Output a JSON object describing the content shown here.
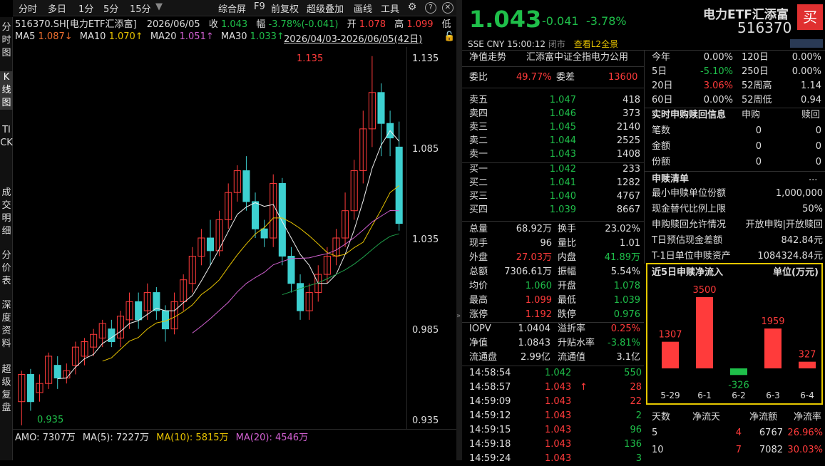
{
  "left_sidebar": [
    "分时图",
    "K线图",
    "TICK",
    "成交明细",
    "分价表",
    "深度资料",
    "超级复盘"
  ],
  "toolbar": {
    "items": [
      "分时",
      "多日",
      "1分",
      "5分",
      "15分"
    ],
    "right_items": [
      "综合屏",
      "F9",
      "前复权",
      "超级叠加",
      "画线",
      "工具"
    ]
  },
  "chart_header": {
    "code": "516370.SH[电力ETF汇添富]",
    "date": "2026/06/05",
    "close_label": "收",
    "close": "1.043",
    "change_label": "幅",
    "change": "-3.78%(-0.041)",
    "open_label": "开",
    "open": "1.078",
    "high_label": "高",
    "high": "1.099",
    "low_label": "低"
  },
  "ma_bar": {
    "ma5": "MA5",
    "ma5v": "1.087↓",
    "ma10": "MA10",
    "ma10v": "1.070↑",
    "ma20": "MA20",
    "ma20v": "1.051↑",
    "ma30": "MA30",
    "ma30v": "1.033↑",
    "range": "2026/04/03-2026/06/05(42日)"
  },
  "price_axis": [
    "1.135",
    "1.085",
    "1.035",
    "0.985",
    "0.935"
  ],
  "annotations": {
    "high": "1.135",
    "low": "0.935"
  },
  "amo": {
    "label": "AMO: 7307万",
    "ma5": "MA(5): 7227万",
    "ma10": "MA(10): 5815万",
    "ma20": "MA(20): 4546万"
  },
  "chart_data": {
    "type": "candlestick",
    "ylim": [
      0.93,
      1.14
    ],
    "candles": [
      [
        0.945,
        0.96,
        0.932,
        0.962
      ],
      [
        0.96,
        0.945,
        0.94,
        0.963
      ],
      [
        0.95,
        0.955,
        0.945,
        0.96
      ],
      [
        0.955,
        0.97,
        0.952,
        0.972
      ],
      [
        0.965,
        0.958,
        0.952,
        0.97
      ],
      [
        0.958,
        0.962,
        0.955,
        0.966
      ],
      [
        0.965,
        0.975,
        0.96,
        0.978
      ],
      [
        0.97,
        0.978,
        0.965,
        0.98
      ],
      [
        0.975,
        0.982,
        0.97,
        0.985
      ],
      [
        0.98,
        0.988,
        0.975,
        0.99
      ],
      [
        0.985,
        0.978,
        0.975,
        0.99
      ],
      [
        0.98,
        0.992,
        0.975,
        0.995
      ],
      [
        0.99,
        1.0,
        0.985,
        1.005
      ],
      [
        1.0,
        0.99,
        0.985,
        1.005
      ],
      [
        0.995,
        1.005,
        0.99,
        1.01
      ],
      [
        1.005,
        0.995,
        0.99,
        1.008
      ],
      [
        0.995,
        0.985,
        0.978,
        0.998
      ],
      [
        0.985,
        1.0,
        0.982,
        1.005
      ],
      [
        1.0,
        1.012,
        0.995,
        1.015
      ],
      [
        1.01,
        1.025,
        1.005,
        1.03
      ],
      [
        1.025,
        1.035,
        1.02,
        1.04
      ],
      [
        1.035,
        1.028,
        1.02,
        1.045
      ],
      [
        1.028,
        1.045,
        1.025,
        1.05
      ],
      [
        1.045,
        1.06,
        1.04,
        1.065
      ],
      [
        1.06,
        1.072,
        1.055,
        1.075
      ],
      [
        1.072,
        1.055,
        1.05,
        1.08
      ],
      [
        1.055,
        1.04,
        1.035,
        1.06
      ],
      [
        1.04,
        1.035,
        1.03,
        1.045
      ],
      [
        1.035,
        1.065,
        1.03,
        1.07
      ],
      [
        1.065,
        1.025,
        1.02,
        1.068
      ],
      [
        1.025,
        1.01,
        1.005,
        1.03
      ],
      [
        1.01,
        0.995,
        0.99,
        1.015
      ],
      [
        0.995,
        1.005,
        0.99,
        1.01
      ],
      [
        1.005,
        1.015,
        1.0,
        1.02
      ],
      [
        1.015,
        1.025,
        1.01,
        1.03
      ],
      [
        1.025,
        1.035,
        1.02,
        1.04
      ],
      [
        1.035,
        1.05,
        1.03,
        1.06
      ],
      [
        1.05,
        1.072,
        1.045,
        1.078
      ],
      [
        1.072,
        1.095,
        1.065,
        1.105
      ],
      [
        1.095,
        1.115,
        1.085,
        1.135
      ],
      [
        1.115,
        1.098,
        1.08,
        1.12
      ],
      [
        1.098,
        1.09,
        1.08,
        1.105
      ],
      [
        1.085,
        1.043,
        1.039,
        1.099
      ]
    ]
  },
  "quote": {
    "price": "1.043",
    "chg": "-0.041",
    "pct": "-3.78%",
    "name": "电力ETF汇添富",
    "code": "516370",
    "buy": "买",
    "exch": "SSE",
    "cur": "CNY",
    "time": "15:00:12",
    "status": "闭市",
    "l2": "查看L2全景"
  },
  "net_title": "净值走势",
  "index_name": "汇添富中证全指电力公用",
  "weibi": {
    "label": "委比",
    "v": "49.77%",
    "label2": "委差",
    "v2": "13600"
  },
  "asks": [
    [
      "卖五",
      "1.047",
      "418"
    ],
    [
      "卖四",
      "1.046",
      "373"
    ],
    [
      "卖三",
      "1.045",
      "2140"
    ],
    [
      "卖二",
      "1.044",
      "2525"
    ],
    [
      "卖一",
      "1.043",
      "1408"
    ]
  ],
  "bids": [
    [
      "买一",
      "1.042",
      "233"
    ],
    [
      "买二",
      "1.041",
      "1282"
    ],
    [
      "买三",
      "1.040",
      "4767"
    ],
    [
      "买四",
      "1.039",
      "8667"
    ]
  ],
  "stats": [
    [
      "总量",
      "68.92万",
      "换手",
      "23.02%"
    ],
    [
      "现手",
      "96",
      "量比",
      "1.01"
    ],
    [
      "外盘",
      "27.03万",
      "内盘",
      "41.89万"
    ],
    [
      "总额",
      "7306.61万",
      "振幅",
      "5.54%"
    ],
    [
      "均价",
      "1.060",
      "开盘",
      "1.078"
    ],
    [
      "最高",
      "1.099",
      "最低",
      "1.039"
    ],
    [
      "涨停",
      "1.192",
      "跌停",
      "0.976"
    ]
  ],
  "iopv": [
    [
      "IOPV",
      "1.0404",
      "溢折率",
      "0.25%"
    ],
    [
      "净值",
      "1.0843",
      "升贴水率",
      "-3.81%"
    ],
    [
      "流通盘",
      "2.99亿",
      "流通值",
      "3.1亿"
    ]
  ],
  "ticks": [
    [
      "14:58:54",
      "1.042",
      "550"
    ],
    [
      "14:58:57",
      "1.043",
      "28"
    ],
    [
      "14:59:09",
      "1.043",
      "22"
    ],
    [
      "14:59:12",
      "1.043",
      "2"
    ],
    [
      "14:59:15",
      "1.043",
      "96"
    ],
    [
      "14:59:18",
      "1.043",
      "136"
    ],
    [
      "14:59:24",
      "1.043",
      "3"
    ]
  ],
  "perf": [
    [
      "今年",
      "0.00%",
      "120日",
      "0.00%"
    ],
    [
      "5日",
      "-5.10%",
      "250日",
      "0.00%"
    ],
    [
      "20日",
      "3.06%",
      "52周高",
      "1.14"
    ],
    [
      "60日",
      "0.00%",
      "52周低",
      "0.94"
    ]
  ],
  "redeem_info": {
    "title": "实时申购赎回信息",
    "col1": "申购",
    "col2": "赎回",
    "rows": [
      [
        "笔数",
        "0",
        "0"
      ],
      [
        "金额",
        "0",
        "0"
      ],
      [
        "份额",
        "0",
        "0"
      ]
    ]
  },
  "redeem_list": {
    "title": "申赎清单",
    "more": "...",
    "rows": [
      [
        "最小申赎单位份额",
        "1,000,000"
      ],
      [
        "现金替代比例上限",
        "50%"
      ],
      [
        "申购赎回允许情况",
        "开放申购|开放赎回"
      ],
      [
        "T日预估现金差额",
        "842.84元"
      ],
      [
        "T-1日单位申赎资产",
        "1084324.84元"
      ]
    ]
  },
  "flow": {
    "title": "近5日申赎净流入",
    "unit": "单位(万元)",
    "chart_data": {
      "type": "bar",
      "categories": [
        "5-29",
        "6-1",
        "6-2",
        "6-3",
        "6-4"
      ],
      "values": [
        1307,
        3500,
        -326,
        1959,
        327
      ]
    }
  },
  "flow_table": {
    "headers": [
      "天数",
      "净流天",
      "净流额",
      "净流率"
    ],
    "rows": [
      [
        "5",
        "4",
        "6767",
        "26.96%"
      ],
      [
        "10",
        "7",
        "7082",
        "30.03%"
      ]
    ]
  },
  "colors": {
    "up": "#ff3b3b",
    "down": "#3dd0d0",
    "green": "#1fbf4a",
    "yellow": "#e6c200"
  }
}
